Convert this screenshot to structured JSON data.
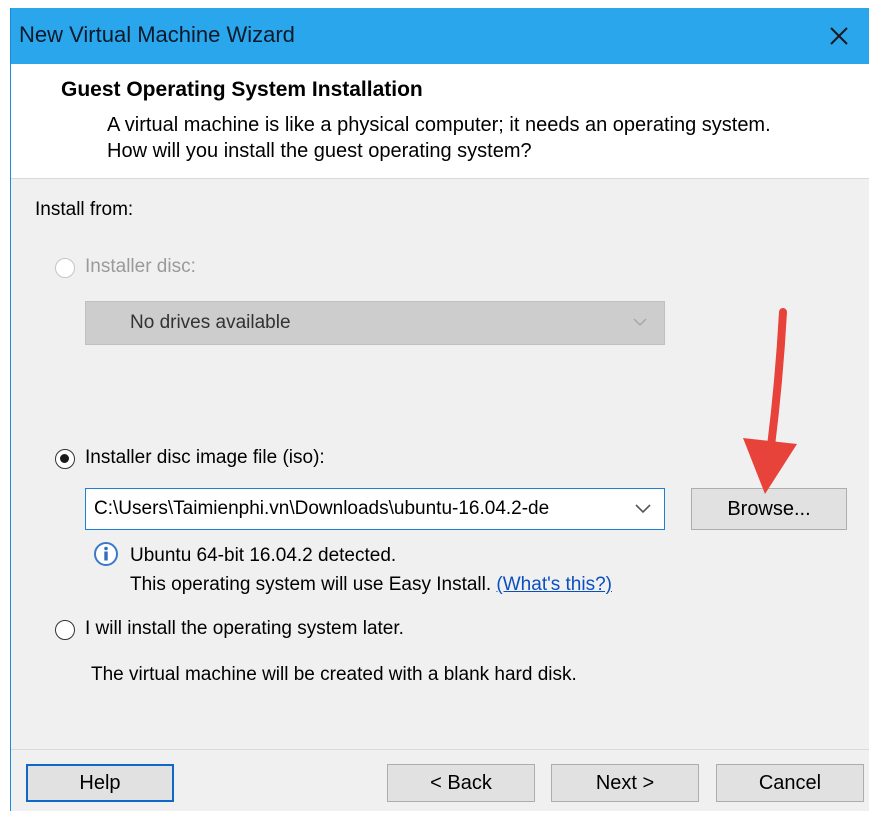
{
  "window": {
    "title": "New Virtual Machine Wizard"
  },
  "header": {
    "title": "Guest Operating System Installation",
    "description": "A virtual machine is like a physical computer; it needs an operating system. How will you install the guest operating system?"
  },
  "install_from": {
    "label": "Install from:",
    "options": {
      "installer_disc": {
        "label": "Installer disc:",
        "selected": false,
        "enabled": false,
        "drive_value": "No drives available"
      },
      "iso": {
        "label": "Installer disc image file (iso):",
        "selected": true,
        "path": "C:\\Users\\Taimienphi.vn\\Downloads\\ubuntu-16.04.2-de",
        "browse_label": "Browse..."
      },
      "later": {
        "label": "I will install the operating system later.",
        "selected": false,
        "note": "The virtual machine will be created with a blank hard disk."
      }
    },
    "detection": {
      "line1": "Ubuntu 64-bit 16.04.2 detected.",
      "line2": "This operating system will use Easy Install.",
      "link": "(What's this?)"
    }
  },
  "footer": {
    "help": "Help",
    "back": "< Back",
    "next": "Next >",
    "cancel": "Cancel"
  },
  "colors": {
    "titlebar": "#2aa6ec",
    "annotation_arrow": "#e8433b",
    "focus": "#0f67c8"
  }
}
